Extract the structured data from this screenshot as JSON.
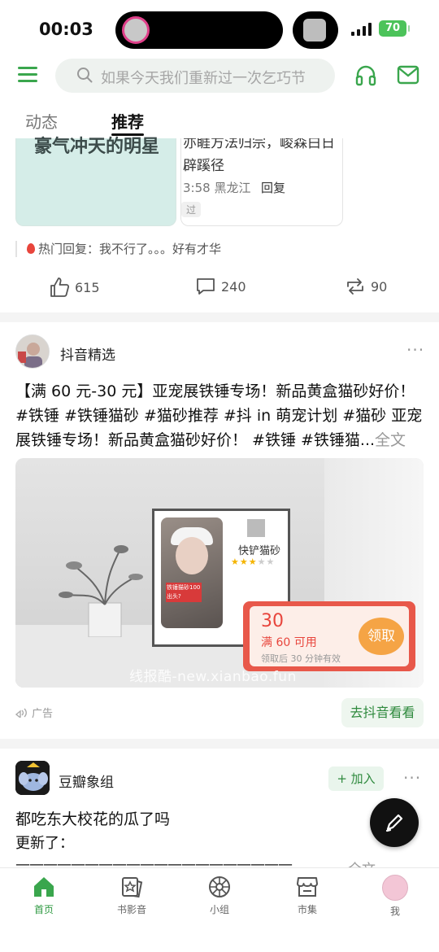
{
  "status_bar": {
    "time": "00:03",
    "battery": "70"
  },
  "search": {
    "placeholder": "如果今天我们重新过一次乞巧节"
  },
  "tabs": [
    {
      "label": "动态"
    },
    {
      "label": "推荐"
    }
  ],
  "post1": {
    "card_a_text": "豪气冲天的明星",
    "card_b_title": "亦睚方法归宗，峻森白日辟蹊径",
    "card_b_meta": "3:58 黑龙江",
    "card_b_reply": "回复",
    "card_b_tag": "过",
    "hot_reply": "热门回复：我不行了。。。好有才华",
    "likes": "615",
    "comments": "240",
    "reposts": "90"
  },
  "post2": {
    "author": "抖音精选",
    "body": "【满 60 元-30 元】亚宠展铁锤专场！新品黄盒猫砂好价！#铁锤 #铁锤猫砂 #猫砂推荐 #抖 in 萌宠计划 #猫砂 亚宠展铁锤专场！新品黄盒猫砂好价！ #铁锤 #铁锤猫...",
    "fulltext": "全文",
    "product_name": "快铲猫砂",
    "photo_label": "铁锤猫砂100出头?",
    "coupon_amount": "30",
    "coupon_condition": "满 60 可用",
    "coupon_expiry": "领取后 30 分钟有效",
    "coupon_button": "领取",
    "watermark": "线报酷-new.xianbao.fun",
    "ad_label": "广告",
    "cta": "去抖音看看"
  },
  "post3": {
    "group": "豆瓣象组",
    "join": "+ 加入",
    "title": "都吃东大校花的瓜了吗",
    "line2": "更新了：",
    "line3": "————————————————————",
    "fulltext": "全文"
  },
  "bottom_nav": [
    {
      "label": "首页",
      "icon": "home-icon",
      "active": true
    },
    {
      "label": "书影音",
      "icon": "book-film-icon",
      "active": false
    },
    {
      "label": "小组",
      "icon": "group-icon",
      "active": false
    },
    {
      "label": "市集",
      "icon": "market-icon",
      "active": false
    },
    {
      "label": "我",
      "icon": "avatar",
      "active": false
    }
  ],
  "colors": {
    "accent": "#2f9a42",
    "coupon": "#e8584a"
  }
}
